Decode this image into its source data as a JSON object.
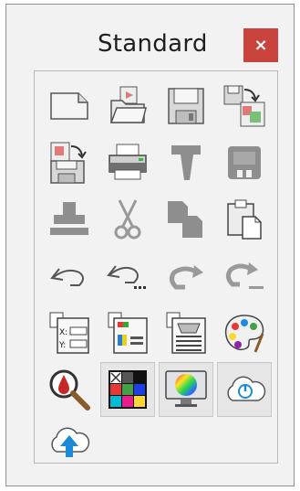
{
  "window": {
    "title": "Standard",
    "close_label": "×"
  },
  "toolbar": {
    "buttons": [
      {
        "name": "new-document-icon",
        "enabled": true
      },
      {
        "name": "open-folder-icon",
        "enabled": true
      },
      {
        "name": "save-icon",
        "enabled": true
      },
      {
        "name": "save-as-icon",
        "enabled": true
      },
      {
        "name": "save-all-icon",
        "enabled": true
      },
      {
        "name": "print-icon",
        "enabled": true
      },
      {
        "name": "pin-icon",
        "enabled": false
      },
      {
        "name": "unpin-icon",
        "enabled": false
      },
      {
        "name": "stamp-icon",
        "enabled": false
      },
      {
        "name": "cut-icon",
        "enabled": false
      },
      {
        "name": "copy-icon",
        "enabled": false
      },
      {
        "name": "paste-icon",
        "enabled": true
      },
      {
        "name": "undo-icon",
        "enabled": true
      },
      {
        "name": "undo-multiple-icon",
        "enabled": true
      },
      {
        "name": "redo-icon",
        "enabled": false
      },
      {
        "name": "redo-multiple-icon",
        "enabled": false
      },
      {
        "name": "xy-form-icon",
        "enabled": true
      },
      {
        "name": "color-form-icon",
        "enabled": true
      },
      {
        "name": "stack-form-icon",
        "enabled": true
      },
      {
        "name": "color-palette-icon",
        "enabled": true
      },
      {
        "name": "color-picker-magnifier-icon",
        "enabled": true
      },
      {
        "name": "color-grid-icon",
        "enabled": true,
        "selected": true
      },
      {
        "name": "color-monitor-icon",
        "enabled": true,
        "selected": true
      },
      {
        "name": "cloud-power-icon",
        "enabled": true,
        "selected": true
      },
      {
        "name": "cloud-upload-icon",
        "enabled": true
      }
    ]
  },
  "colors": {
    "close_bg": "#c9443c",
    "disabled_gray": "#9a9a9a",
    "accent_blue": "#1e8ad6"
  }
}
